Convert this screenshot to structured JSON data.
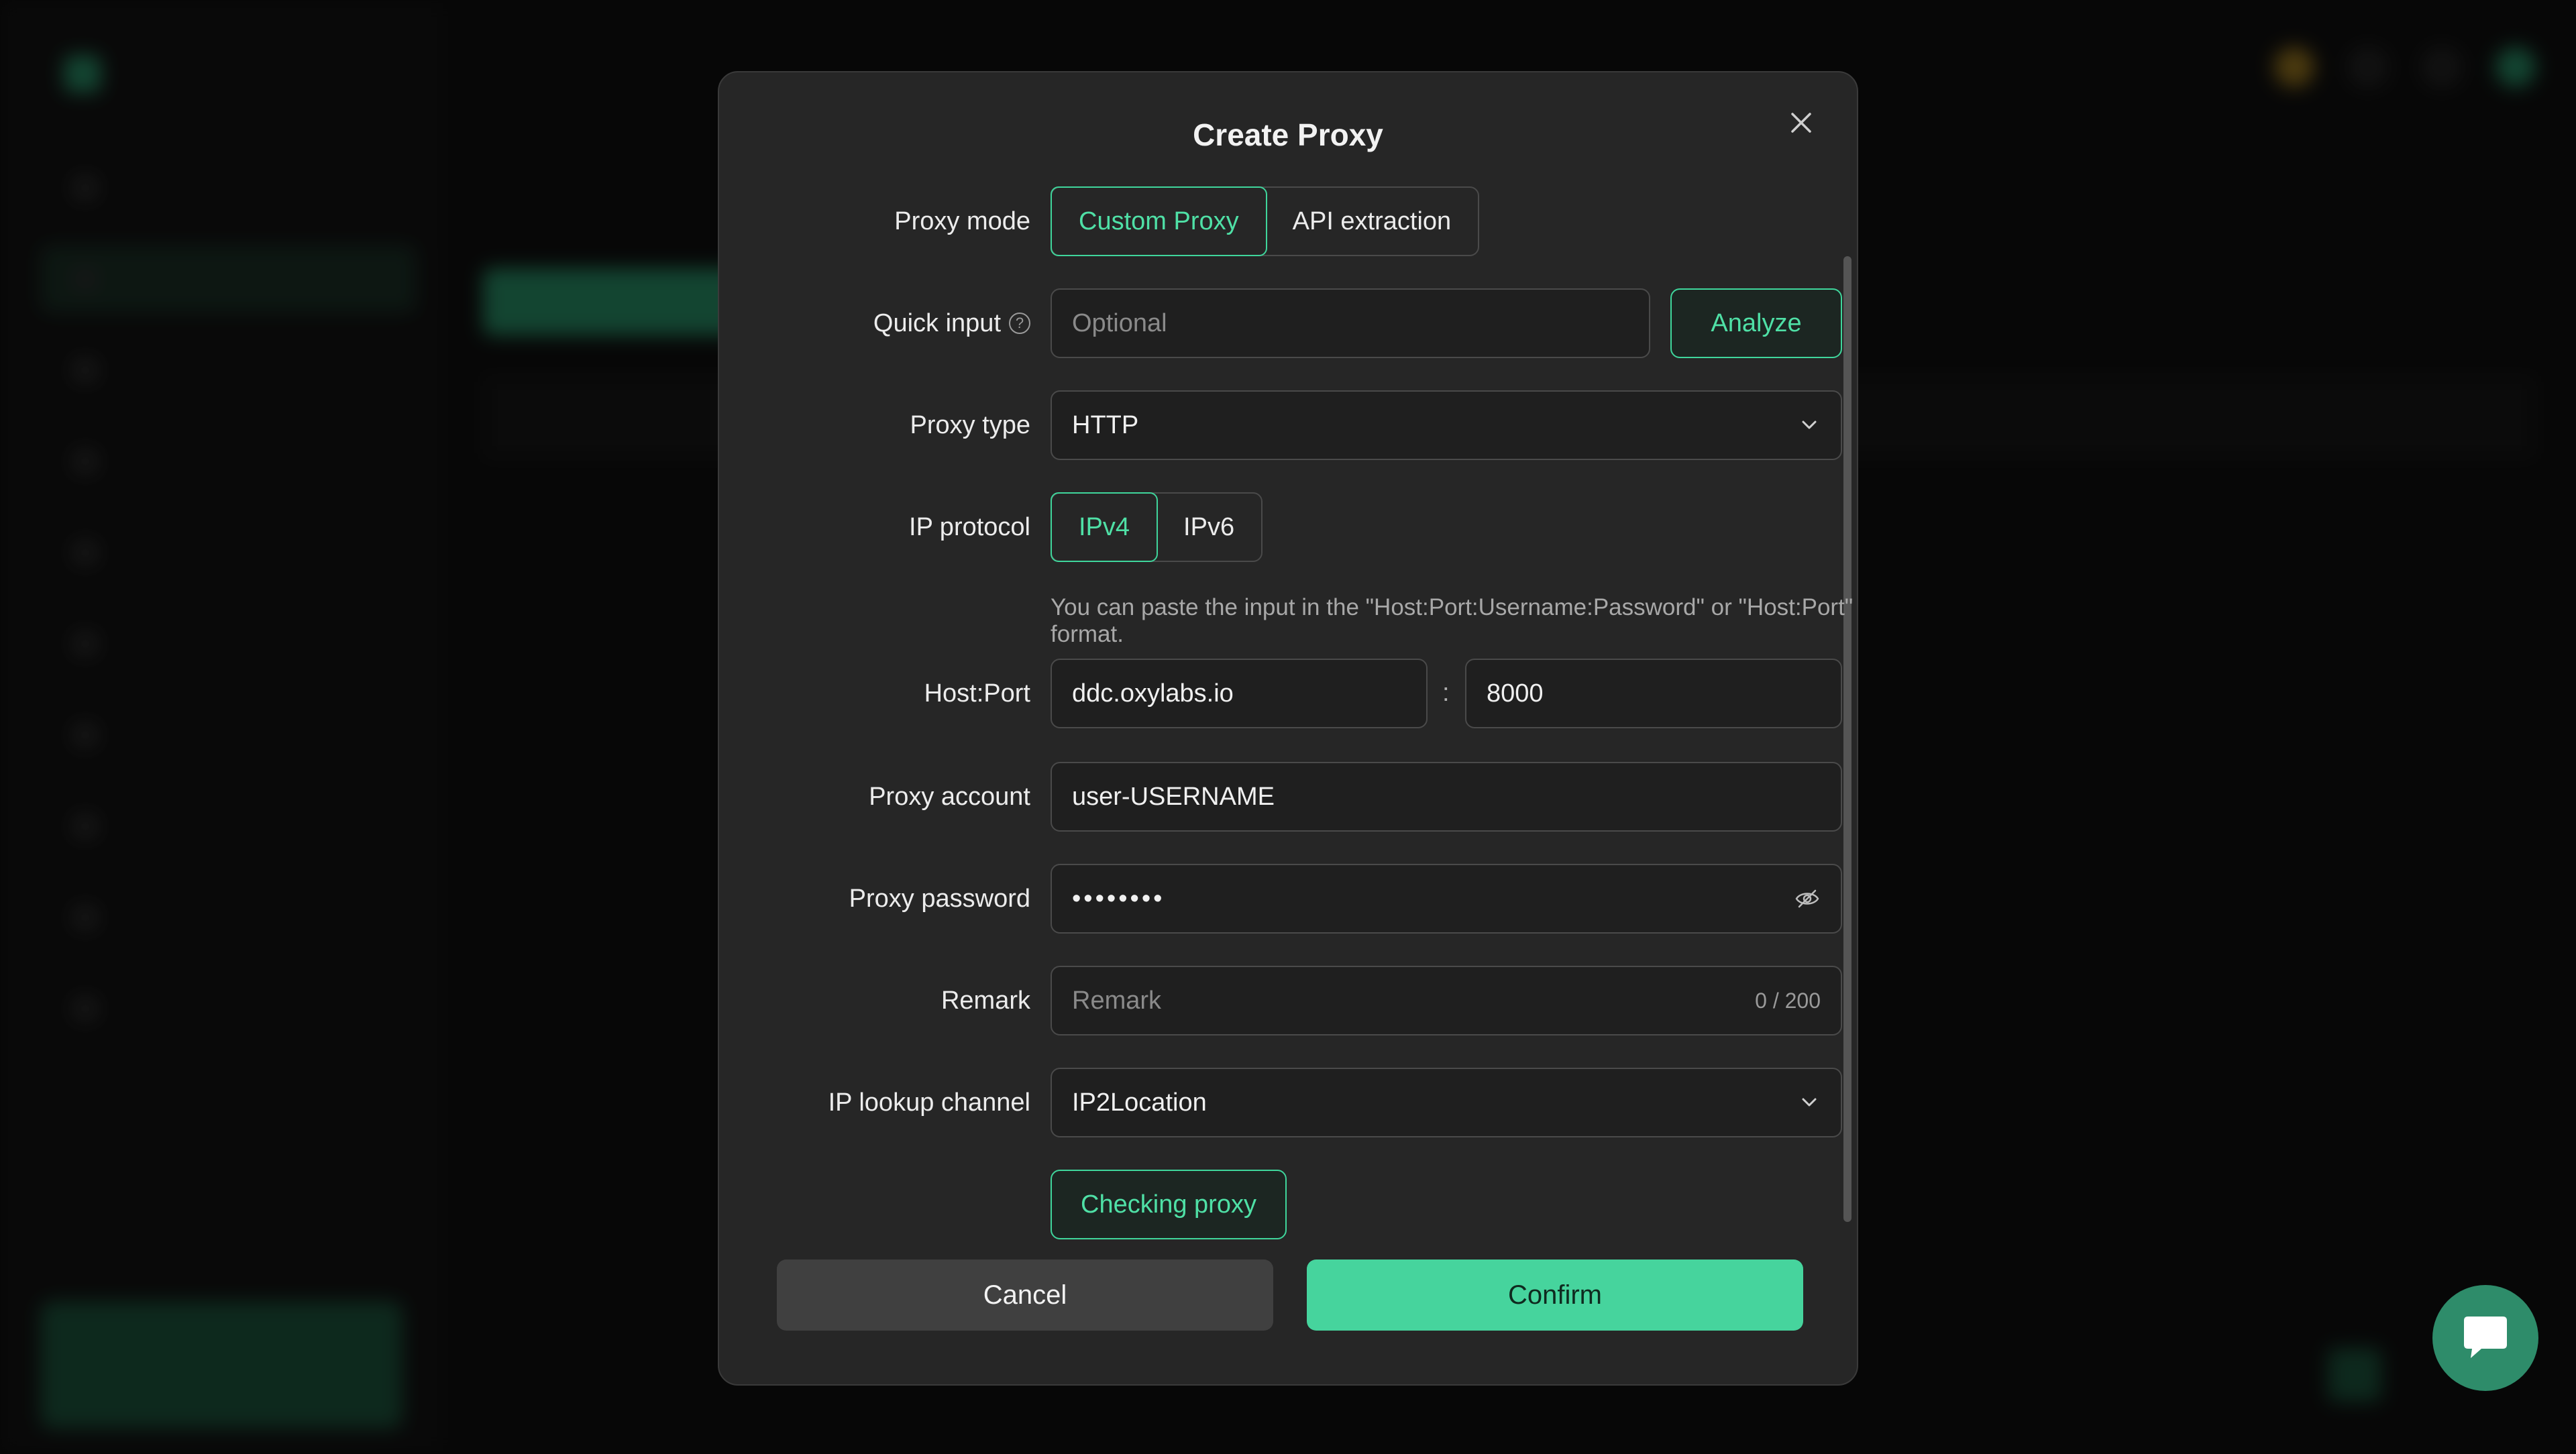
{
  "colors": {
    "accent": "#46d49d",
    "modal_bg": "#262626",
    "field_bg": "#1f1f1f"
  },
  "modal": {
    "title": "Create Proxy",
    "close_icon": "close-icon",
    "proxy_mode": {
      "label": "Proxy mode",
      "options": [
        "Custom Proxy",
        "API extraction"
      ],
      "selected": "Custom Proxy"
    },
    "quick_input": {
      "label": "Quick input",
      "placeholder": "Optional",
      "help_icon": "question-circle-icon",
      "analyze_label": "Analyze"
    },
    "proxy_type": {
      "label": "Proxy type",
      "value": "HTTP"
    },
    "ip_protocol": {
      "label": "IP protocol",
      "options": [
        "IPv4",
        "IPv6"
      ],
      "selected": "IPv4"
    },
    "host_port": {
      "hint": "You can paste the input in the \"Host:Port:Username:Password\" or \"Host:Port\" format.",
      "label": "Host:Port",
      "host": "ddc.oxylabs.io",
      "separator": ":",
      "port": "8000"
    },
    "proxy_account": {
      "label": "Proxy account",
      "value": "user-USERNAME"
    },
    "proxy_password": {
      "label": "Proxy password",
      "value": "••••••••",
      "icon": "eye-off-icon"
    },
    "remark": {
      "label": "Remark",
      "placeholder": "Remark",
      "counter": "0 / 200"
    },
    "ip_lookup": {
      "label": "IP lookup channel",
      "value": "IP2Location"
    },
    "checking_label": "Checking proxy",
    "cancel_label": "Cancel",
    "confirm_label": "Confirm"
  },
  "chat": {
    "icon": "chat-bubble-icon"
  }
}
